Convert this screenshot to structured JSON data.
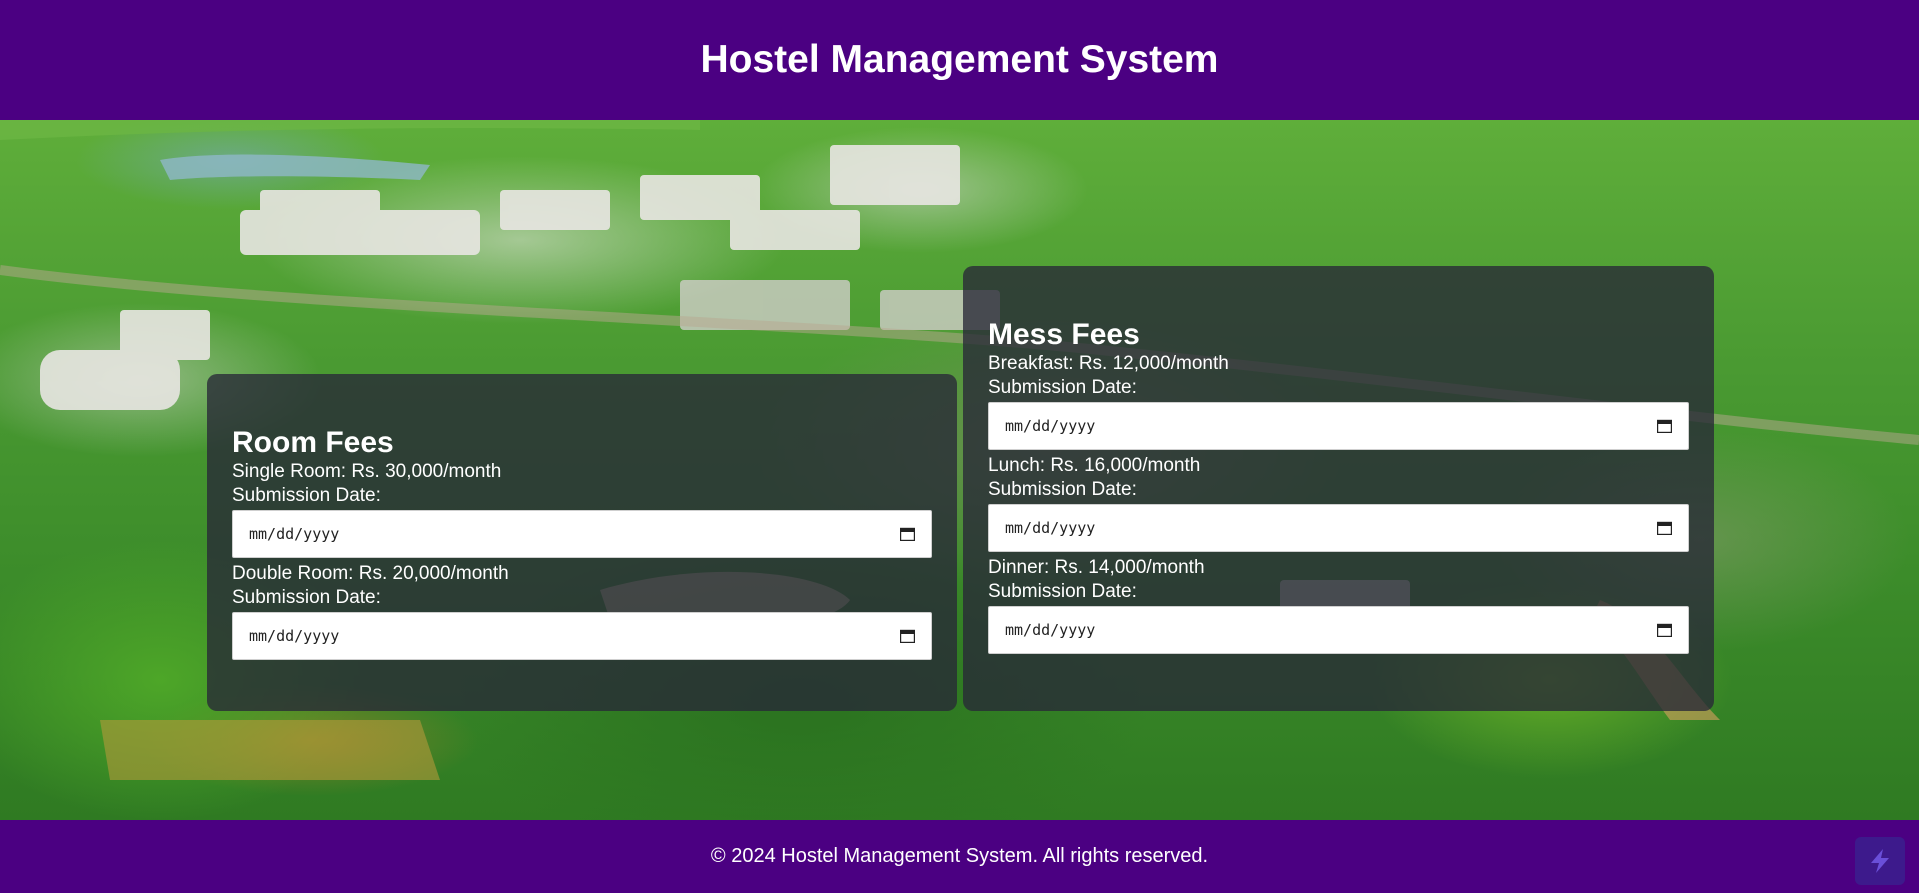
{
  "header": {
    "title": "Hostel Management System"
  },
  "room_fees": {
    "title": "Room Fees",
    "items": [
      {
        "label": "Single Room: Rs. 30,000/month",
        "date_label": "Submission Date:",
        "date_placeholder": "mm/dd/yyyy"
      },
      {
        "label": "Double Room: Rs. 20,000/month",
        "date_label": "Submission Date:",
        "date_placeholder": "mm/dd/yyyy"
      }
    ]
  },
  "mess_fees": {
    "title": "Mess Fees",
    "items": [
      {
        "label": "Breakfast: Rs. 12,000/month",
        "date_label": "Submission Date:",
        "date_placeholder": "mm/dd/yyyy"
      },
      {
        "label": "Lunch: Rs. 16,000/month",
        "date_label": "Submission Date:",
        "date_placeholder": "mm/dd/yyyy"
      },
      {
        "label": "Dinner: Rs. 14,000/month",
        "date_label": "Submission Date:",
        "date_placeholder": "mm/dd/yyyy"
      }
    ]
  },
  "footer": {
    "text": "© 2024 Hostel Management System. All rights reserved."
  },
  "icons": {
    "date_picker": "calendar-icon",
    "corner": "app-badge-icon"
  },
  "colors": {
    "brand": "#4b0082",
    "card_bg": "rgba(40,40,55,0.78)"
  }
}
